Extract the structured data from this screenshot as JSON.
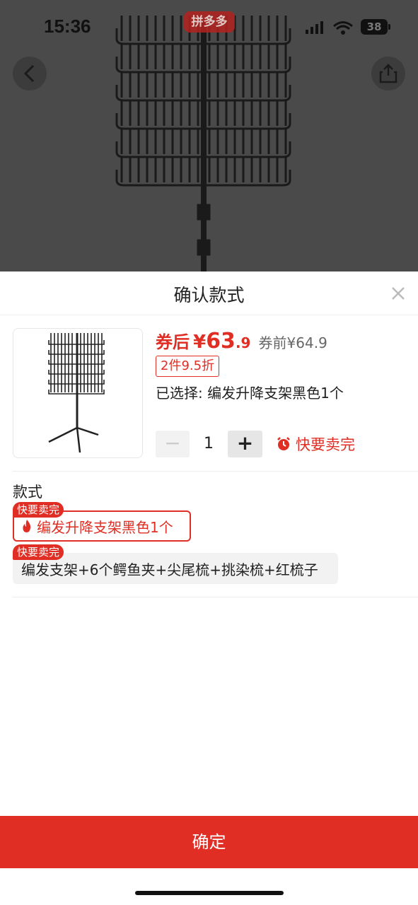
{
  "status_bar": {
    "time": "15:36",
    "battery": "38"
  },
  "top_logo": "拼多多",
  "sheet": {
    "title": "确认款式",
    "price": {
      "prefix": "券后",
      "currency": "¥",
      "integer": "63",
      "decimal": ".9",
      "before_label": "券前¥64.9"
    },
    "discount_tag": "2件9.5折",
    "selected": "已选择: 编发升降支架黑色1个",
    "quantity": "1",
    "minus_label": "−",
    "plus_label": "+",
    "sellout_text": "快要卖完",
    "style_label": "款式",
    "options": [
      {
        "badge": "快要卖完",
        "label": "编发升降支架黑色1个",
        "selected": true
      },
      {
        "badge": "快要卖完",
        "label": "编发支架+6个鳄鱼夹+尖尾梳+挑染梳+红梳子",
        "selected": false
      }
    ],
    "confirm_label": "确定"
  },
  "colors": {
    "accent": "#e02e24"
  }
}
